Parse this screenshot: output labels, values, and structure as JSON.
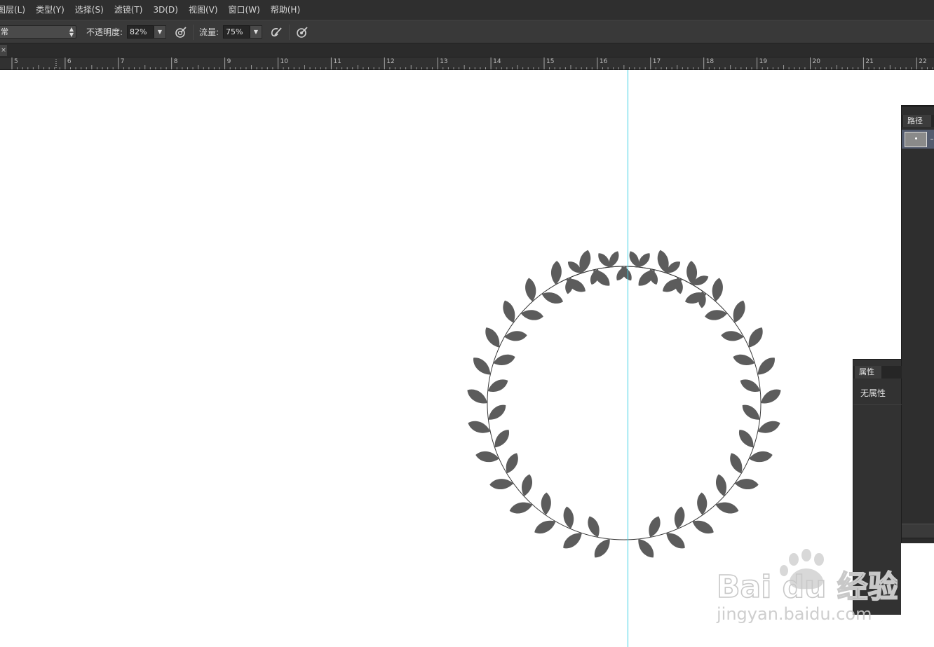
{
  "menubar": {
    "items": [
      {
        "label": "图层(L)"
      },
      {
        "label": "类型(Y)"
      },
      {
        "label": "选择(S)"
      },
      {
        "label": "滤镜(T)"
      },
      {
        "label": "3D(D)"
      },
      {
        "label": "视图(V)"
      },
      {
        "label": "窗口(W)"
      },
      {
        "label": "帮助(H)"
      }
    ]
  },
  "options": {
    "mode_value": "常",
    "opacity_label": "不透明度:",
    "opacity_value": "82%",
    "flow_label": "流量:",
    "flow_value": "75%",
    "icons": [
      "pressure-opacity-icon",
      "airbrush-icon",
      "pressure-size-icon"
    ]
  },
  "tabstrip": {
    "close_glyph": "×"
  },
  "ruler": {
    "numbers": [
      "5",
      "6",
      "7",
      "8",
      "9",
      "10",
      "11",
      "12",
      "13",
      "14",
      "15",
      "16",
      "17",
      "18",
      "19",
      "20",
      "21",
      "22"
    ]
  },
  "paths_panel": {
    "tab_label": "路径"
  },
  "properties_panel": {
    "tab_label": "属性",
    "content_text": "无属性"
  },
  "watermark": {
    "brand": "Bai du 经验",
    "url": "jingyan.baidu.com"
  },
  "colors": {
    "ui_dark": "#2f2f2f",
    "guide": "#3fd2e6",
    "leaf": "#5c5c5c",
    "path_selected": "#535b6e"
  }
}
